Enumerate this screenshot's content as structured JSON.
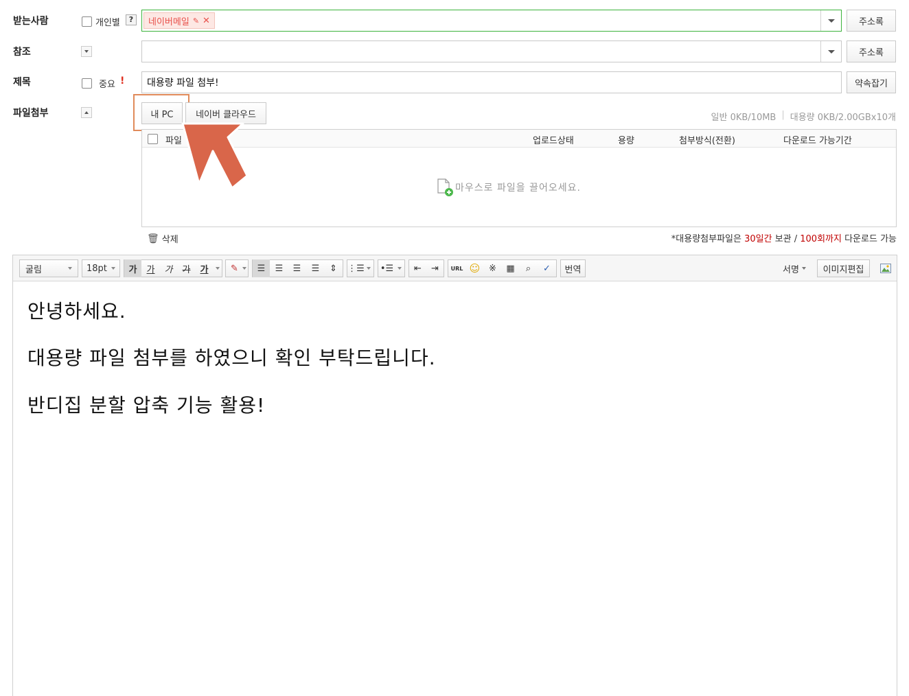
{
  "recipient": {
    "label": "받는사람",
    "individual_label": "개인별",
    "help": "?",
    "tag": "네이버메일",
    "address_book": "주소록"
  },
  "cc": {
    "label": "참조",
    "address_book": "주소록"
  },
  "subject": {
    "label": "제목",
    "important_label": "중요",
    "important_mark": "!",
    "value": "대용량 파일 첨부!",
    "reserve_button": "약속잡기"
  },
  "attach": {
    "label": "파일첨부",
    "my_pc": "내 PC",
    "cloud": "네이버 클라우드",
    "usage_general": "일반 0KB/10MB",
    "separator": "|",
    "usage_large": "대용량 0KB/2.00GBx10개",
    "columns": {
      "file": "파일",
      "status": "업로드상태",
      "size": "용량",
      "method": "첨부방식(전환)",
      "period": "다운로드 가능기간"
    },
    "drop_hint": "마우스로 파일을 끌어오세요.",
    "delete": "삭제",
    "note_prefix": "*대용량첨부파일은 ",
    "note_days": "30일간",
    "note_mid": " 보관 / ",
    "note_count": "100회까지",
    "note_suffix": " 다운로드 가능"
  },
  "toolbar": {
    "font": "굴림",
    "size": "18pt",
    "bold": "가",
    "underline": "가",
    "italic": "가",
    "strike": "가",
    "color": "가",
    "url": "URL",
    "translate": "번역",
    "signature": "서명",
    "image_edit": "이미지편집"
  },
  "body": {
    "line1": "안녕하세요.",
    "line2": "대용량 파일 첨부를 하였으니 확인 부탁드립니다.",
    "line3": "반디집 분할 압축 기능 활용!"
  },
  "colors": {
    "accent_green": "#3bb33b",
    "tag_red": "#e8504a",
    "highlight_orange": "#e08a5a",
    "arrow": "#d9664a",
    "note_red": "#c00000"
  }
}
